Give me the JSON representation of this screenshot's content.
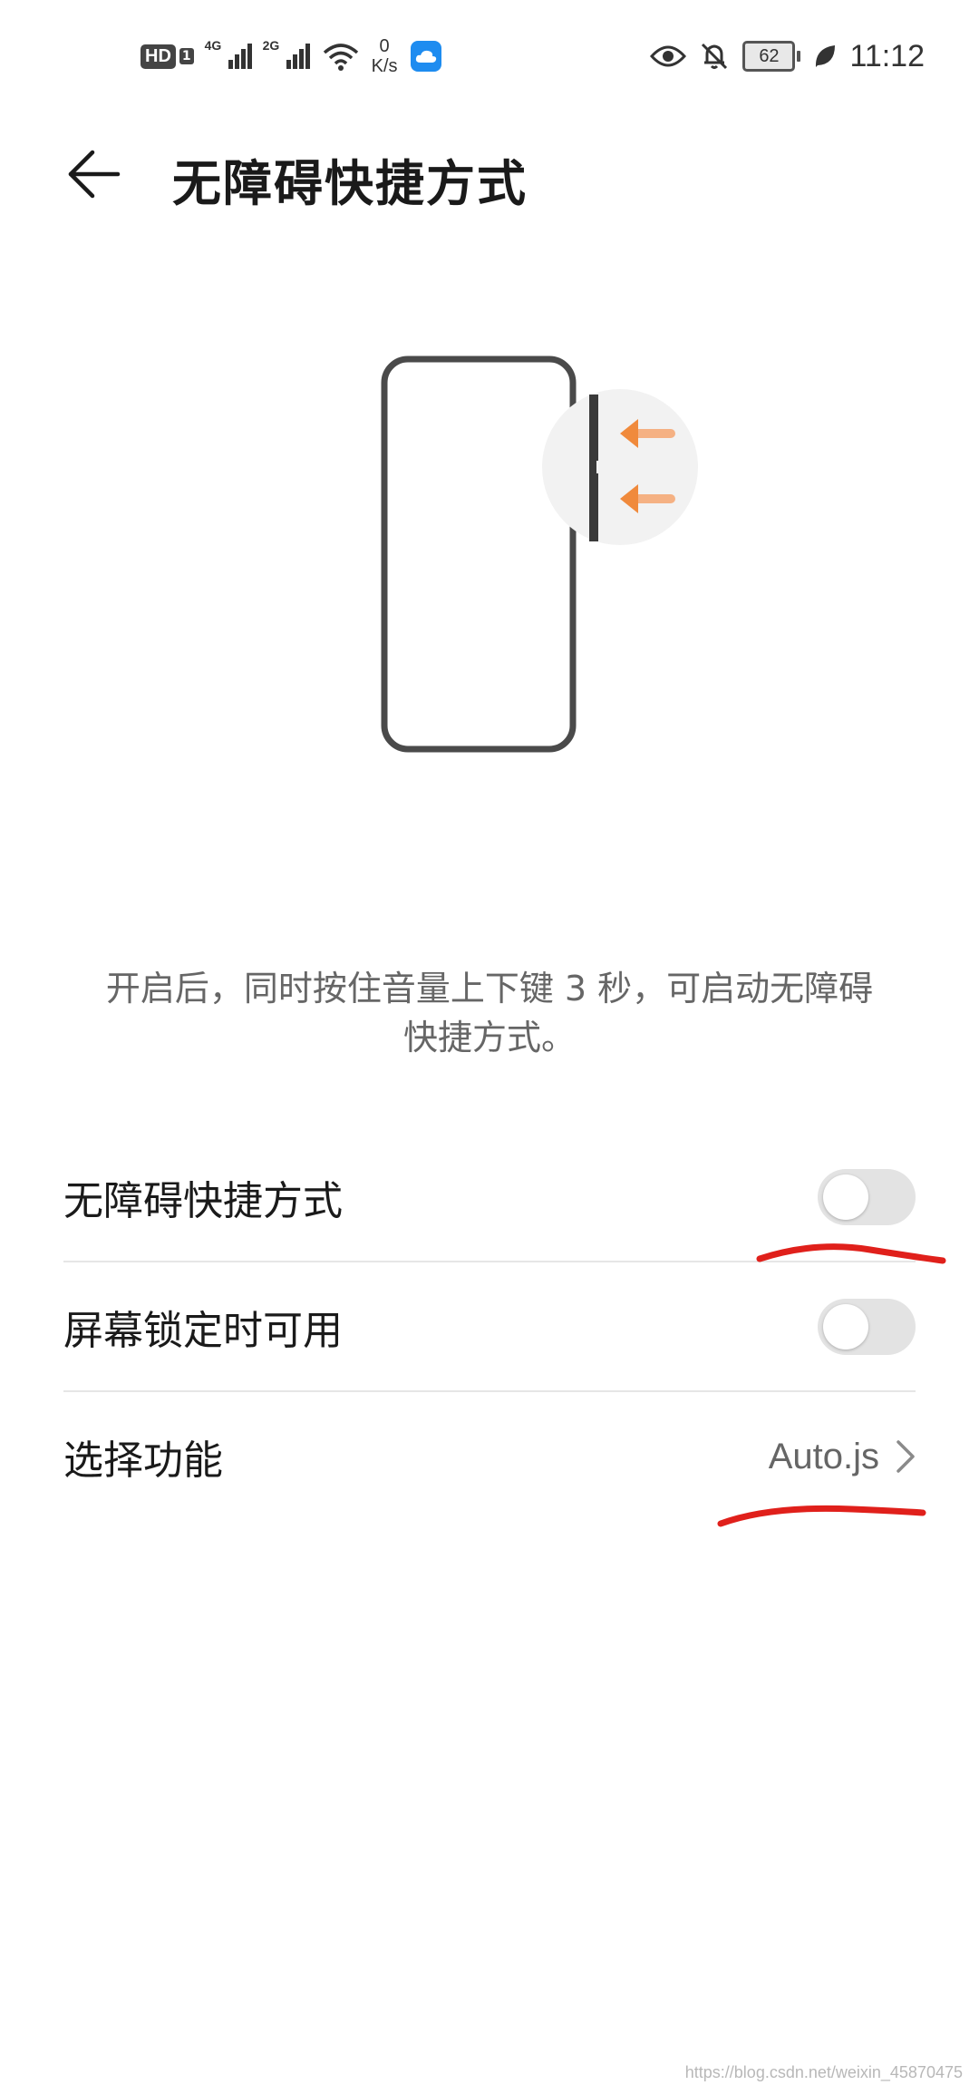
{
  "status_bar": {
    "hd_label": "HD",
    "hd_sim": "1",
    "signal_1_label": "4G",
    "signal_2_label": "2G",
    "net_speed_value": "0",
    "net_speed_unit": "K/s",
    "battery_level": "62",
    "time": "11:12",
    "icons": [
      "hd-icon",
      "signal-4g-icon",
      "signal-2g-icon",
      "wifi-icon",
      "cloud-icon",
      "eye-icon",
      "bell-muted-icon",
      "battery-icon",
      "leaf-icon"
    ]
  },
  "header": {
    "title": "无障碍快捷方式",
    "back_icon": "arrow-left-icon"
  },
  "illustration": {
    "accent_color": "#f08a3c",
    "frame_color": "#4a4a4a"
  },
  "description": {
    "line1": "开启后，同时按住音量上下键 3 秒，可启动无障碍",
    "line2": "快捷方式。"
  },
  "settings": {
    "shortcut_toggle": {
      "label": "无障碍快捷方式",
      "enabled": false
    },
    "lockscreen_toggle": {
      "label": "屏幕锁定时可用",
      "enabled": false
    },
    "choose_function": {
      "label": "选择功能",
      "value": "Auto.js"
    }
  },
  "annotation_color": "#e0201b",
  "watermark": "https://blog.csdn.net/weixin_45870475"
}
